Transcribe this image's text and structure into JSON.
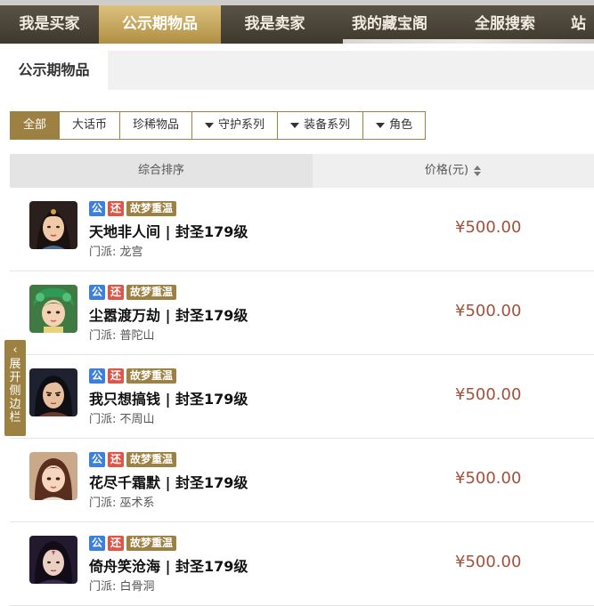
{
  "nav": {
    "items": [
      {
        "label": "我是买家"
      },
      {
        "label": "公示期物品"
      },
      {
        "label": "我是卖家"
      },
      {
        "label": "我的藏宝阁"
      },
      {
        "label": "全服搜索"
      },
      {
        "label": "站"
      }
    ],
    "active_index": 1
  },
  "subtab": {
    "label": "公示期物品"
  },
  "filters": [
    {
      "label": "全部",
      "active": true
    },
    {
      "label": "大话币"
    },
    {
      "label": "珍稀物品"
    },
    {
      "label": "守护系列",
      "dropdown": true
    },
    {
      "label": "装备系列",
      "dropdown": true
    },
    {
      "label": "角色",
      "dropdown": true
    }
  ],
  "table": {
    "sort_header": "综合排序",
    "price_header": "价格(元)"
  },
  "rows": [
    {
      "name": "天地非人间 | 封圣179级",
      "sect_label": "门派: 龙宫",
      "price": "¥500.00",
      "badge_gong": "公",
      "badge_huan": "还",
      "server": "故梦重温"
    },
    {
      "name": "尘嚣渡万劫 | 封圣179级",
      "sect_label": "门派: 普陀山",
      "price": "¥500.00",
      "badge_gong": "公",
      "badge_huan": "还",
      "server": "故梦重温"
    },
    {
      "name": "我只想搞钱 | 封圣179级",
      "sect_label": "门派: 不周山",
      "price": "¥500.00",
      "badge_gong": "公",
      "badge_huan": "还",
      "server": "故梦重温"
    },
    {
      "name": "花尽千霜默 | 封圣179级",
      "sect_label": "门派: 巫术系",
      "price": "¥500.00",
      "badge_gong": "公",
      "badge_huan": "还",
      "server": "故梦重温"
    },
    {
      "name": "倚舟笑沧海 | 封圣179级",
      "sect_label": "门派: 白骨洞",
      "price": "¥500.00",
      "badge_gong": "公",
      "badge_huan": "还",
      "server": "故梦重温"
    }
  ],
  "sidebar_toggle": {
    "label": "展开侧边栏",
    "chevron": "‹"
  },
  "colors": {
    "accent": "#9c8142",
    "nav_dark": "#4a4337",
    "price": "#a0523a",
    "badge_blue": "#3d7fdc",
    "badge_red": "#e05548"
  }
}
